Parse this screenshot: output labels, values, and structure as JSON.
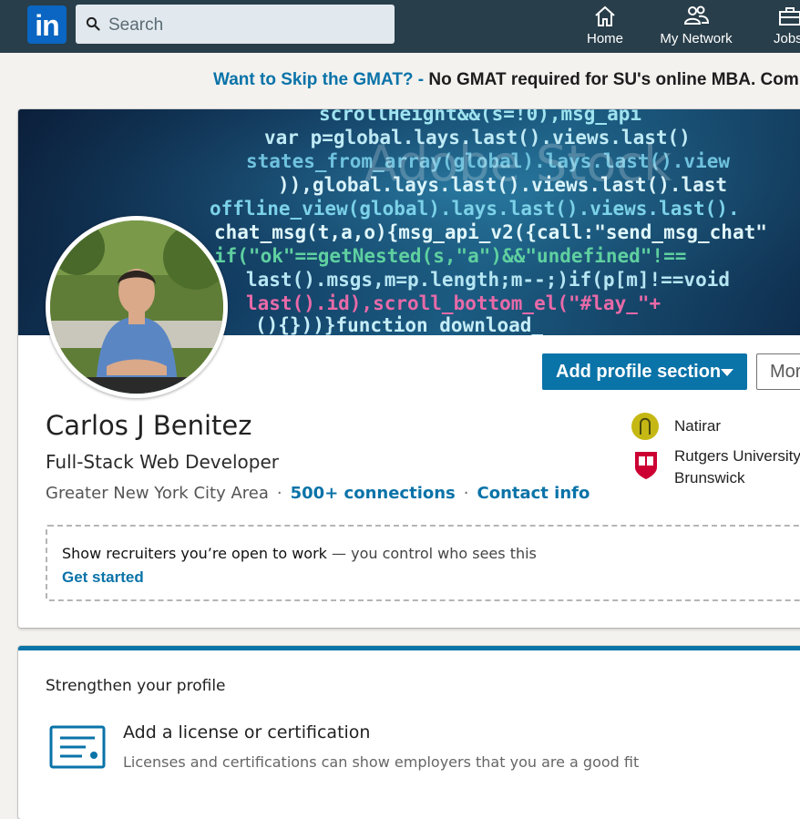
{
  "nav": {
    "logo_text": "in",
    "search_placeholder": "Search",
    "items": [
      {
        "label": "Home",
        "icon": "home-icon"
      },
      {
        "label": "My Network",
        "icon": "network-icon"
      },
      {
        "label": "Jobs",
        "icon": "jobs-icon"
      }
    ]
  },
  "ad": {
    "link_text": "Want to Skip the GMAT? -",
    "body_text": " No GMAT required for SU's online MBA. Comp"
  },
  "profile": {
    "banner_code": [
      "scrollHeight&&(s=!0),msg_api",
      "var p=global.lays.last().views.last()",
      "states_from_array(global).lays.last().view",
      ")),global.lays.last().views.last().last",
      "offline_view(global).lays.last().views.last().",
      "chat_msg(t,a,o){msg_api_v2({call:\"send_msg_chat\"",
      "if(\"ok\"==getNested(s,\"a\")&&\"undefined\"!==",
      "last().msgs,m=p.length;m--;)if(p[m]!==void",
      "last().id),scroll_bottom_el(\"#lay_\"+",
      "(){}))}function download_"
    ],
    "watermark": "Adobe Stock",
    "name": "Carlos J Benitez",
    "headline": "Full-Stack Web Developer",
    "location": "Greater New York City Area",
    "separator": "·",
    "connections": "500+ connections",
    "contact": "Contact info",
    "add_section_label": "Add profile section",
    "more_label": "More",
    "current_company": "Natirar",
    "education_line1": "Rutgers University",
    "education_line2": "Brunswick",
    "open_to_work": {
      "bold": "Show recruiters you’re open to work",
      "rest": " — you control who sees this",
      "link": "Get started"
    }
  },
  "strengthen": {
    "title": "Strengthen your profile",
    "item_title": "Add a license or certification",
    "item_desc": "Licenses and certifications can show employers that you are a good fit"
  },
  "colors": {
    "nav_bg": "#283e4a",
    "brand_blue": "#0a73a8",
    "page_bg": "#f3f2ef"
  }
}
